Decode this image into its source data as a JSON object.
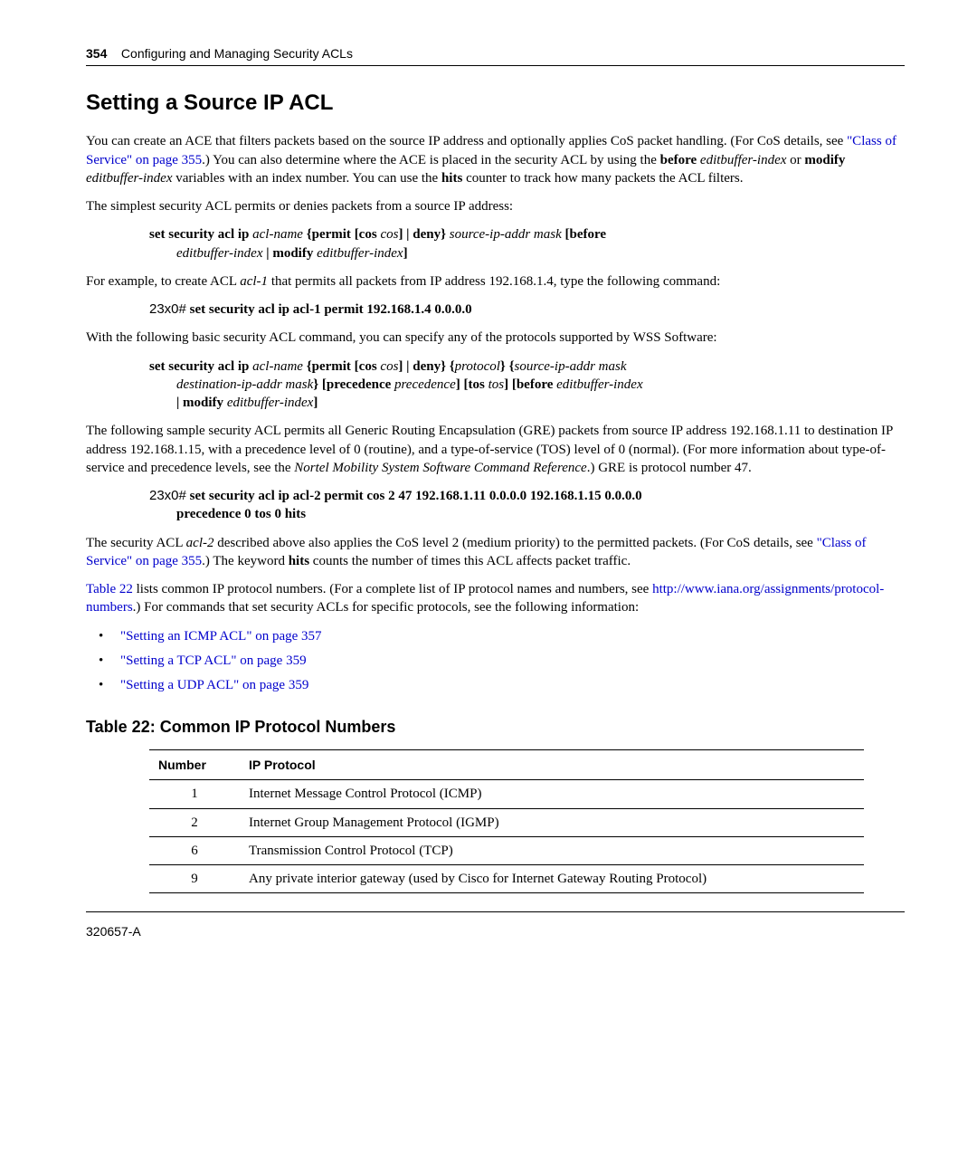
{
  "header": {
    "page_number": "354",
    "chapter": "Configuring and Managing Security ACLs"
  },
  "title": "Setting a Source IP ACL",
  "para1_pre": "You can create an ACE that filters packets based on the source IP address and optionally applies CoS packet handling. (For CoS details, see ",
  "para1_link": "\"Class of Service\" on page 355",
  "para1_post1": ".) You can also determine where the ACE is placed in the security ACL by using the ",
  "para1_b1": "before",
  "para1_i1": " editbuffer-index",
  "para1_mid": " or ",
  "para1_b2": "modify",
  "para1_i2": " editbuffer-index",
  "para1_post2": " variables with an index number. You can use the ",
  "para1_b3": "hits",
  "para1_post3": " counter to track how many packets the ACL filters.",
  "para2": "The simplest security ACL permits or denies packets from a source IP address:",
  "syntax1_line1": {
    "b1": "set security acl ip",
    "i1": " acl-name ",
    "b2": "{permit ",
    "b3": "[cos ",
    "i2": "cos",
    "b4": "]  |  deny}",
    "i3": " source-ip-addr  mask ",
    "b5": "[before"
  },
  "syntax1_line2": {
    "i1": "editbuffer-index  ",
    "b1": "|  modify ",
    "i2": "editbuffer-index",
    "b2": "]"
  },
  "para3_pre": "For example, to create ACL ",
  "para3_i": "acl-1",
  "para3_post": " that permits all packets from IP address 192.168.1.4, type the following command:",
  "cmd1_prompt": "23x0#",
  "cmd1": " set security acl ip acl-1 permit 192.168.1.4 0.0.0.0",
  "para4": "With the following basic security ACL command, you can specify any of the protocols supported by WSS Software:",
  "syntax2_line1": {
    "b1": "set security acl ip  ",
    "i1": "acl-name ",
    "b2": "{permit [cos ",
    "i2": " cos",
    "b3": "]  |  deny}  {",
    "i3": "protocol",
    "b4": "}  {",
    "i4": "source-ip-addr  mask"
  },
  "syntax2_line2": {
    "i1": "destination-ip-addr  mask",
    "b1": "}  [precedence ",
    "i2": " precedence",
    "b2": "]  [tos ",
    "i3": " tos",
    "b3": "]  [before ",
    "i4": "editbuffer-index"
  },
  "syntax2_line3": {
    "b1": "|  modify ",
    "i1": "editbuffer-index",
    "b2": "]"
  },
  "para5_pre": "The following sample security ACL permits all Generic Routing Encapsulation (GRE) packets from source IP address 192.168.1.11 to destination IP address 192.168.1.15, with a precedence level of 0 (routine), and a type-of-service (TOS) level of 0 (normal). (For more information about type-of-service and precedence levels, see the ",
  "para5_i": "Nortel Mobility System Software Command Reference",
  "para5_post": ".) GRE is protocol number 47.",
  "cmd2_prompt": "23x0#",
  "cmd2_l1": " set security acl ip acl-2 permit cos 2 47 192.168.1.11 0.0.0.0 192.168.1.15 0.0.0.0",
  "cmd2_l2": "precedence 0 tos 0 hits",
  "para6_pre": "The security ACL ",
  "para6_i1": "acl-2",
  "para6_mid1": " described above also applies the CoS level 2 (medium priority) to the permitted packets. (For CoS details, see ",
  "para6_link": "\"Class of Service\" on page 355",
  "para6_mid2": ".) The keyword ",
  "para6_b": "hits",
  "para6_post": " counts the number of times this ACL affects packet traffic.",
  "para7_link1": "Table 22",
  "para7_mid": " lists common IP protocol numbers. (For a complete list of IP protocol names and numbers, see ",
  "para7_link2": "http://www.iana.org/assignments/protocol-numbers",
  "para7_post": ".) For commands that set security ACLs for specific protocols, see the following information:",
  "bullets": [
    "\"Setting an ICMP ACL\" on page 357",
    "\"Setting a TCP ACL\" on page 359",
    "\"Setting a UDP ACL\" on page 359"
  ],
  "table_title": "Table 22: Common IP Protocol Numbers",
  "table": {
    "head_num": "Number",
    "head_proto": "IP Protocol",
    "rows": [
      {
        "num": "1",
        "proto": "Internet Message Control Protocol (ICMP)"
      },
      {
        "num": "2",
        "proto": "Internet Group Management Protocol (IGMP)"
      },
      {
        "num": "6",
        "proto": "Transmission Control Protocol (TCP)"
      },
      {
        "num": "9",
        "proto": "Any private interior gateway (used by Cisco for Internet Gateway Routing Protocol)"
      }
    ]
  },
  "footer": "320657-A"
}
